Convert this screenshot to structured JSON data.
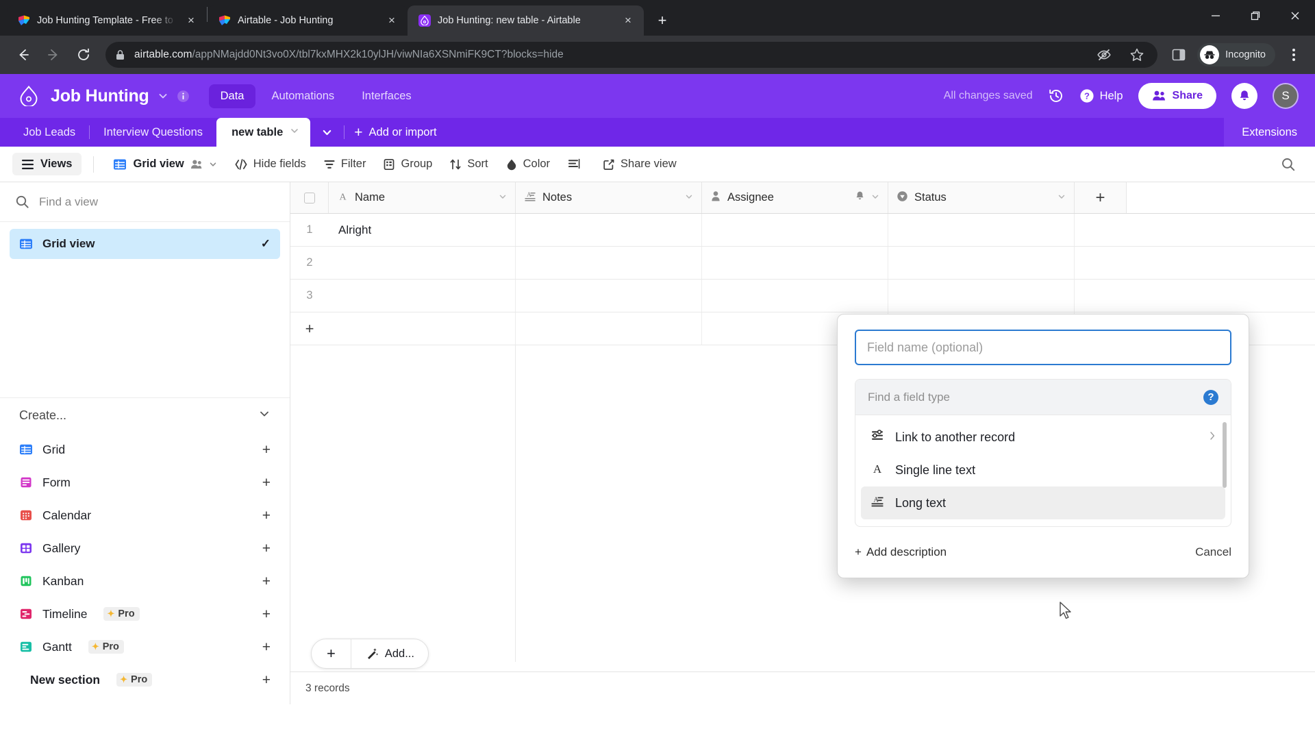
{
  "browser": {
    "tabs": [
      {
        "title": "Job Hunting Template - Free to U",
        "favicon": "airtable-template-icon",
        "active": false,
        "close_label": "×"
      },
      {
        "title": "Airtable - Job Hunting",
        "favicon": "airtable-template-icon",
        "active": false,
        "close_label": "×"
      },
      {
        "title": "Job Hunting: new table - Airtable",
        "favicon": "airtable-base-icon",
        "active": true,
        "close_label": "×"
      }
    ],
    "new_tab_label": "+",
    "window_controls": {
      "minimize": "minimize-icon",
      "maximize": "maximize-icon",
      "close": "close-icon"
    },
    "omnibox": {
      "lock_icon": "lock-icon",
      "url_host": "airtable.com",
      "url_path": "/appNMajdd0Nt3vo0X/tbl7kxMHX2k10ylJH/viwNIa6XSNmiFK9CT?blocks=hide",
      "icons": [
        "eye-slash-icon",
        "star-icon",
        "side-panel-icon"
      ]
    },
    "incognito_label": "Incognito",
    "menu_label": "chrome-menu-icon"
  },
  "header": {
    "base_icon": "airtable-base-icon",
    "base_title": "Job Hunting",
    "caret": "chevron-down-icon",
    "info": "info-icon",
    "nav": [
      {
        "label": "Data",
        "active": true
      },
      {
        "label": "Automations",
        "active": false
      },
      {
        "label": "Interfaces",
        "active": false
      }
    ],
    "saved_status": "All changes saved",
    "history_icon": "history-icon",
    "help_label": "Help",
    "share_label": "Share",
    "bell_icon": "bell-icon",
    "avatar_initial": "S"
  },
  "table_bar": {
    "tables": [
      {
        "label": "Job Leads",
        "active": false
      },
      {
        "label": "Interview Questions",
        "active": false
      },
      {
        "label": "new table",
        "active": true
      }
    ],
    "active_caret": "chevron-down-icon",
    "all_tables_caret": "chevron-down-icon",
    "add_label": "Add or import",
    "extensions_label": "Extensions"
  },
  "view_bar": {
    "views_label": "Views",
    "current_view": "Grid view",
    "items": [
      {
        "label": "Hide fields",
        "icon": "hide-fields-icon"
      },
      {
        "label": "Filter",
        "icon": "filter-icon"
      },
      {
        "label": "Group",
        "icon": "group-icon"
      },
      {
        "label": "Sort",
        "icon": "sort-icon"
      },
      {
        "label": "Color",
        "icon": "color-icon"
      },
      {
        "label": "",
        "icon": "row-height-icon"
      },
      {
        "label": "Share view",
        "icon": "share-view-icon"
      }
    ],
    "search_icon": "search-icon"
  },
  "sidebar": {
    "search_placeholder": "Find a view",
    "views": [
      {
        "label": "Grid view",
        "icon": "grid-icon",
        "selected": true,
        "check": "✓"
      }
    ],
    "create_label": "Create...",
    "create_items": [
      {
        "label": "Grid",
        "icon": "grid-icon",
        "pro": false
      },
      {
        "label": "Form",
        "icon": "form-icon",
        "pro": false
      },
      {
        "label": "Calendar",
        "icon": "calendar-icon",
        "pro": false
      },
      {
        "label": "Gallery",
        "icon": "gallery-icon",
        "pro": false
      },
      {
        "label": "Kanban",
        "icon": "kanban-icon",
        "pro": false
      },
      {
        "label": "Timeline",
        "icon": "timeline-icon",
        "pro": true
      },
      {
        "label": "Gantt",
        "icon": "gantt-icon",
        "pro": true
      },
      {
        "label": "New section",
        "icon": "",
        "pro": true
      }
    ],
    "pro_label": "Pro"
  },
  "grid": {
    "columns": [
      {
        "label": "Name",
        "icon": "text-field-icon"
      },
      {
        "label": "Notes",
        "icon": "long-text-field-icon"
      },
      {
        "label": "Assignee",
        "icon": "user-field-icon"
      },
      {
        "label": "Status",
        "icon": "select-field-icon"
      }
    ],
    "add_field_label": "+",
    "rows": [
      {
        "num": "1",
        "Name": "Alright",
        "Notes": "",
        "Assignee": "",
        "Status": ""
      },
      {
        "num": "2",
        "Name": "",
        "Notes": "",
        "Assignee": "",
        "Status": ""
      },
      {
        "num": "3",
        "Name": "",
        "Notes": "",
        "Assignee": "",
        "Status": ""
      }
    ],
    "add_row_label": "+",
    "add_record_plus": "+",
    "add_record_ai_label": "Add...",
    "record_count": "3 records"
  },
  "field_popup": {
    "name_placeholder": "Field name (optional)",
    "name_value": "",
    "type_search_placeholder": "Find a field type",
    "help_icon": "help-circle-icon",
    "types": [
      {
        "label": "Link to another record",
        "icon": "link-record-icon",
        "has_submenu": true,
        "hovered": false
      },
      {
        "label": "Single line text",
        "icon": "single-line-text-icon",
        "has_submenu": false,
        "hovered": false
      },
      {
        "label": "Long text",
        "icon": "long-text-icon",
        "has_submenu": false,
        "hovered": true
      }
    ],
    "add_description_label": "Add description",
    "cancel_label": "Cancel"
  }
}
